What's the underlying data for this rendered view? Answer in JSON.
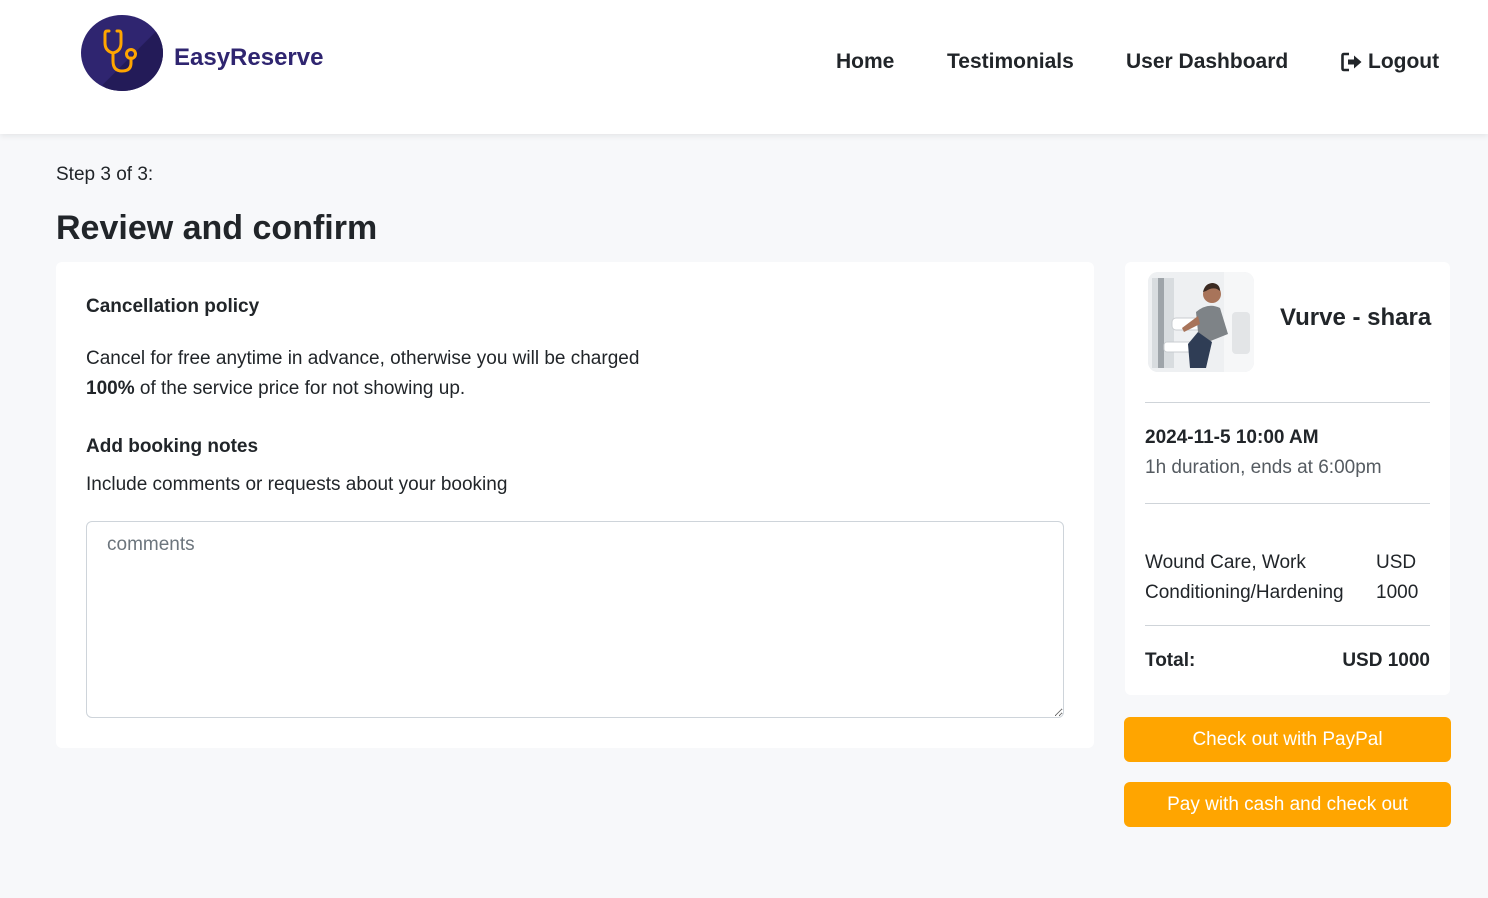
{
  "brand": {
    "name": "EasyReserve"
  },
  "nav": {
    "home": "Home",
    "testimonials": "Testimonials",
    "dashboard": "User Dashboard",
    "logout": "Logout"
  },
  "page": {
    "step": "Step 3 of 3:",
    "title": "Review and confirm"
  },
  "policy": {
    "heading": "Cancellation policy",
    "text_line1": "Cancel for free anytime in advance, otherwise you will be charged",
    "percent": "100%",
    "text_line2": " of the service price for not showing up."
  },
  "notes": {
    "heading": "Add booking notes",
    "description": "Include comments or requests about your booking",
    "placeholder": "comments",
    "value": ""
  },
  "summary": {
    "provider_name": "Vurve - shara",
    "date": "2024-11-5 10:00 AM",
    "duration": "1h duration, ends at 6:00pm",
    "service": "Wound Care, Work Conditioning/Hardening",
    "service_price": "USD 1000",
    "total_label": "Total:",
    "total_value": "USD 1000"
  },
  "buttons": {
    "paypal": "Check out with PayPal",
    "cash": "Pay with cash and check out"
  },
  "colors": {
    "brand": "#2f2570",
    "accent": "#ffa500",
    "logo_icon": "#ffa500"
  },
  "icons": {
    "logo": "stethoscope-icon",
    "logout": "sign-out-icon"
  }
}
